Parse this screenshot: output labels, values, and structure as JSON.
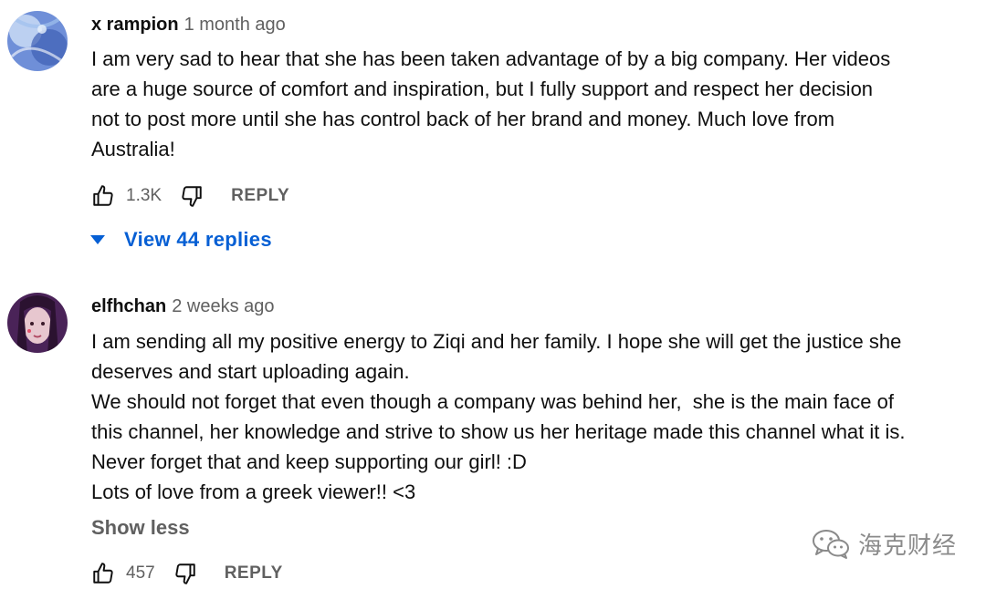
{
  "comments": [
    {
      "author": "x rampion",
      "time": "1 month ago",
      "lines": [
        "I am very sad to hear that she has been taken advantage of by a big company. Her videos",
        "are a huge source of comfort and inspiration, but I fully support and respect her decision",
        "not to post more until she has control back of her brand and money. Much love from",
        "Australia!"
      ],
      "likes": "1.3K",
      "reply_label": "REPLY",
      "view_replies": "View 44 replies",
      "avatar_colors": [
        "#6f8fd8",
        "#cfe0f7",
        "#3e5fb5"
      ]
    },
    {
      "author": "elfhchan",
      "time": "2 weeks ago",
      "lines": [
        "I am sending all my positive energy to Ziqi and her family. I hope she will get the justice she",
        "deserves and start uploading again.",
        "We should not forget that even though a company was behind her,  she is the main face of",
        "this channel, her knowledge and strive to show us her heritage made this channel what it is.",
        "Never forget that and keep supporting our girl! :D",
        "Lots of love from a greek viewer!! <3"
      ],
      "show_less": "Show less",
      "likes": "457",
      "reply_label": "REPLY",
      "avatar_colors": [
        "#4a2358",
        "#e7c7cf",
        "#2b1230"
      ]
    }
  ],
  "watermark": {
    "text": "海克财经",
    "icon": "wechat-icon"
  },
  "colors": {
    "link_blue": "#065fd4",
    "secondary_text": "#606060",
    "primary_text": "#0f0f0f"
  }
}
